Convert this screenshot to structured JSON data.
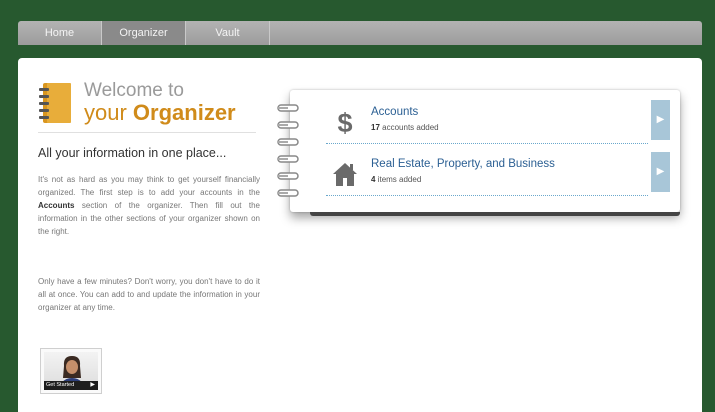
{
  "nav": {
    "tabs": [
      "Home",
      "Organizer",
      "Vault"
    ],
    "active_tab": "Organizer"
  },
  "welcome": {
    "line1": "Welcome to",
    "line2_prefix": "your ",
    "line2_bold": "Organizer"
  },
  "intro": {
    "headline": "All your information in one place...",
    "p1_before": "It's not as hard as you may think to get yourself financially organized. The first step is to add your accounts in the ",
    "p1_bold": "Accounts",
    "p1_after": " section of the organizer. Then fill out the information in the other sections of your organizer shown on the right.",
    "p2": "Only have a few minutes? Don't worry, you don't have to do it all at once. You can add to and update the information in your organizer at any time."
  },
  "video": {
    "caption": "Get Started",
    "icon": "play-icon"
  },
  "sections": [
    {
      "title": "Accounts",
      "count": "17",
      "count_suffix": "accounts added",
      "icon": "dollar-icon"
    },
    {
      "title": "Real Estate, Property, and Business",
      "count": "4",
      "count_suffix": "items added",
      "icon": "house-icon"
    }
  ],
  "colors": {
    "background": "#27592f",
    "accent_orange": "#d08b1a",
    "link_blue": "#2b5f93",
    "arrow_tab": "#a8c6d8"
  }
}
